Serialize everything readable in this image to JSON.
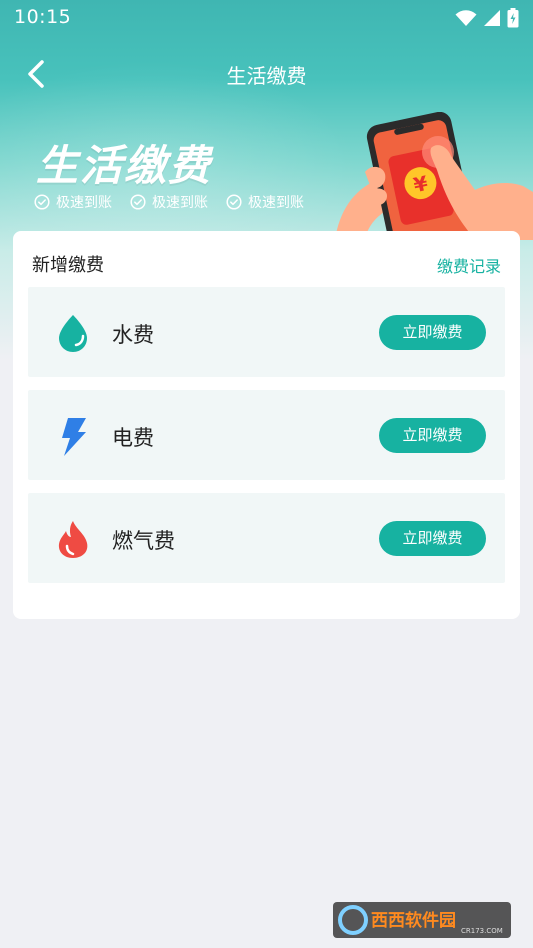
{
  "status_bar": {
    "time": "10:15"
  },
  "nav": {
    "title": "生活缴费"
  },
  "banner": {
    "title": "生活缴费",
    "features": [
      "极速到账",
      "极速到账",
      "极速到账"
    ]
  },
  "card": {
    "title": "新增缴费",
    "history_link": "缴费记录",
    "items": [
      {
        "label": "水费",
        "button": "立即缴费",
        "icon": "water-drop-icon",
        "color": "#17b2a1"
      },
      {
        "label": "电费",
        "button": "立即缴费",
        "icon": "lightning-bolt-icon",
        "color": "#2f7fe6"
      },
      {
        "label": "燃气费",
        "button": "立即缴费",
        "icon": "flame-icon",
        "color": "#ef4b43"
      }
    ]
  },
  "watermark": {
    "brand": "西西软件园",
    "domain": "CR173.COM"
  },
  "colors": {
    "accent": "#17b2a1",
    "hero": "#48c2bc",
    "background": "#eff0f4"
  }
}
